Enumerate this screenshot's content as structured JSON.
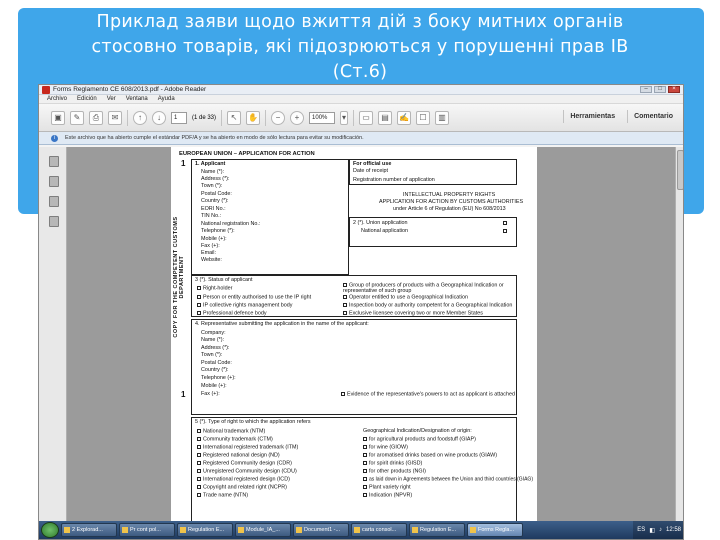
{
  "slide": {
    "title_line1": "Приклад заяви щодо вжиття дій з боку митних органів",
    "title_line2": "стосовно товарів, які підозрюються у порушенні прав ІВ",
    "title_line3": "(Ст.6)",
    "header_color": "#3fa6ea"
  },
  "window": {
    "title": "Forms Reglamento CE 608/2013.pdf - Adobe Reader",
    "menu": [
      "Archivo",
      "Edición",
      "Ver",
      "Ventana",
      "Ayuda"
    ]
  },
  "toolbar": {
    "page_current": "1",
    "page_total": "(1 de 33)",
    "zoom": "100%",
    "tools_label": "Herramientas",
    "comment_label": "Comentario"
  },
  "notice": {
    "text": "Este archivo que ha abierto cumple el estándar PDF/A y se ha abierto en modo de sólo lectura para evitar su modificación."
  },
  "form": {
    "header": "EUROPEAN UNION – APPLICATION FOR ACTION",
    "side_label": "COPY FOR THE COMPETENT CUSTOMS DEPARTMENT",
    "box_number": "1",
    "applicant_title": "1. Applicant",
    "applicant_fields": [
      "Name (*):",
      "Address (*):",
      "Town (*):",
      "Postal Code:",
      "Country (*):",
      "EORI No.:",
      "TIN No.:",
      "National registration No.:",
      "Telephone (*):",
      "Mobile (+):",
      "Fax (+):",
      "Email:",
      "Website:"
    ],
    "official_use_title": "For official use",
    "date_receipt": "Date of receipt",
    "registration_number": "Registration number of application",
    "ipr_title_1": "INTELLECTUAL PROPERTY RIGHTS",
    "ipr_title_2": "APPLICATION FOR ACTION BY CUSTOMS AUTHORITIES",
    "ipr_title_3": "under Article 6 of Regulation (EU) No 608/2013",
    "union_application": "2 (*). Union application",
    "national_application": "National application",
    "status_title": "3 (*). Status of applicant",
    "status_left": [
      "Right-holder",
      "Person or entity authorised to use the IP right",
      "IP collective rights management body",
      "Professional defence body"
    ],
    "status_right": [
      "Group of producers of products with a Geographical Indication or representative of such group",
      "Operator entitled to use a Geographical Indication",
      "Inspection body or authority competent for a Geographical Indication",
      "Exclusive licensee covering two or more Member States"
    ],
    "representative_title": "4. Representative submitting the application in the name of the applicant:",
    "rep_fields": [
      "Company:",
      "Name (*):",
      "Address (*):",
      "Town (*):",
      "Postal Code:",
      "Country (*):",
      "Telephone (+):",
      "Mobile (+):",
      "Fax (+):"
    ],
    "evidence_label": "Evidence of the representative's powers to act as applicant is attached",
    "right_type_title": "5 (*). Type of right to which the application refers",
    "right_types_left": [
      "National trademark (NTM)",
      "Community trademark (CTM)",
      "International registered trademark (ITM)",
      "Registered national design (ND)",
      "Registered Community design (CDR)",
      "Unregistered Community design (CDU)",
      "International registered design (ICD)",
      "Copyright and related right (NCPR)",
      "Trade name (NTN)"
    ],
    "gi_title": "Geographical Indication/Designation of origin:",
    "right_types_right": [
      "for agricultural products and foodstuff (GIAP)",
      "for wine (GIOW)",
      "for aromatised drinks based on wine products (GIAW)",
      "for spirit drinks (GISD)",
      "for other products (NGI)",
      "as laid down in Agreements between the Union and third countries (GIAG)",
      "Plant variety right",
      "Indication (NPVR)"
    ]
  },
  "taskbar": {
    "tasks": [
      "2 Explorad...",
      "Pr cont pol...",
      "Regulation E...",
      "Module_IA_...",
      "Document1 -...",
      "carta consol...",
      "Regulation E...",
      "Forms Regla..."
    ],
    "lang": "ES",
    "time": "12:58"
  }
}
